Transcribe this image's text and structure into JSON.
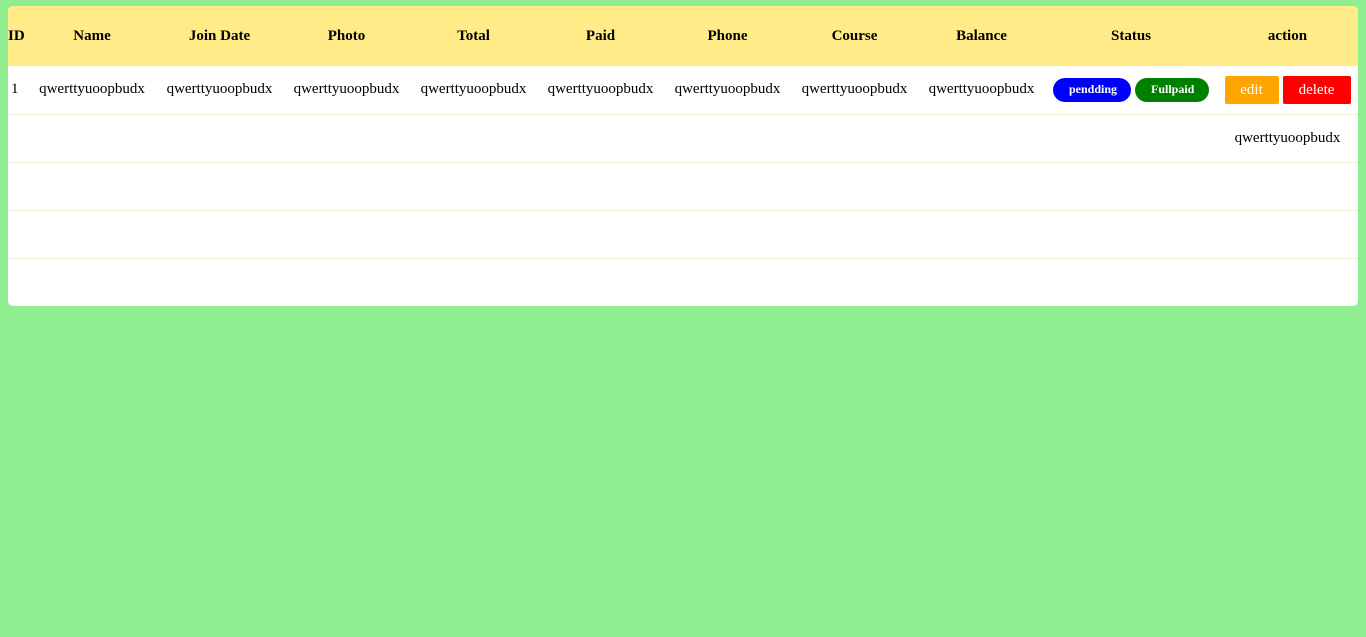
{
  "columns": [
    "ID",
    "Name",
    "Join Date",
    "Photo",
    "Total",
    "Paid",
    "Phone",
    "Course",
    "Balance",
    "Status",
    "action"
  ],
  "rows": [
    {
      "id": "1",
      "name": "qwerttyuoopbudx",
      "join_date": "qwerttyuoopbudx",
      "photo": "qwerttyuoopbudx",
      "total": "qwerttyuoopbudx",
      "paid": "qwerttyuoopbudx",
      "phone": "qwerttyuoopbudx",
      "course": "qwerttyuoopbudx",
      "balance": "qwerttyuoopbudx",
      "status_pending": "pendding",
      "status_fullpaid": "Fullpaid",
      "edit_label": "edit",
      "delete_label": "delete"
    }
  ],
  "row2_action_text": "qwerttyuoopbudx",
  "colors": {
    "background": "#90ee90",
    "header": "#ffeb88",
    "pending": "#0000ff",
    "fullpaid": "#008000",
    "edit": "#ffa500",
    "delete": "#ff0000"
  }
}
